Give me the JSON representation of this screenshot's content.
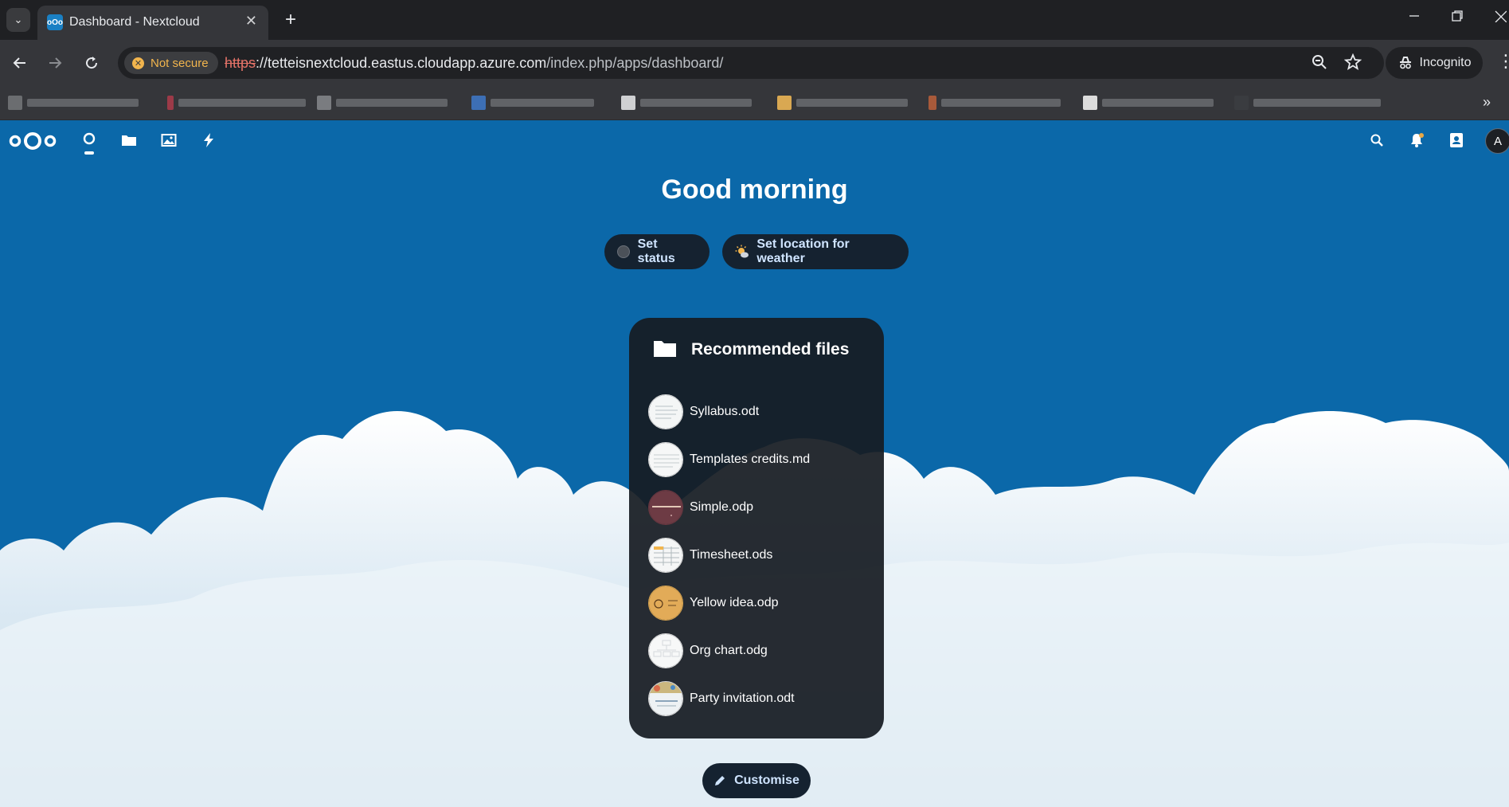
{
  "browser": {
    "tab_title": "Dashboard - Nextcloud",
    "tab_close": "✕",
    "new_tab": "+",
    "security_chip": "Not secure",
    "url_scheme": "https",
    "url_host": "://tetteisnextcloud.eastus.cloudapp.azure.com",
    "url_path": "/index.php/apps/dashboard/",
    "incognito_label": "Incognito"
  },
  "header": {
    "apps": [
      "Dashboard",
      "Files",
      "Photos",
      "Activity"
    ],
    "avatar_initial": "A"
  },
  "main": {
    "greeting": "Good morning",
    "set_status_label": "Set status",
    "weather_label": "Set location for weather",
    "customise_label": "Customise"
  },
  "widget": {
    "title": "Recommended files",
    "files": [
      {
        "name": "Syllabus.odt"
      },
      {
        "name": "Templates credits.md"
      },
      {
        "name": "Simple.odp"
      },
      {
        "name": "Timesheet.ods"
      },
      {
        "name": "Yellow idea.odp"
      },
      {
        "name": "Org chart.odg"
      },
      {
        "name": "Party invitation.odt"
      }
    ]
  },
  "colors": {
    "brand_blue": "#0b68a9",
    "pill_bg": "#152230",
    "not_secure": "#f2b54d"
  }
}
